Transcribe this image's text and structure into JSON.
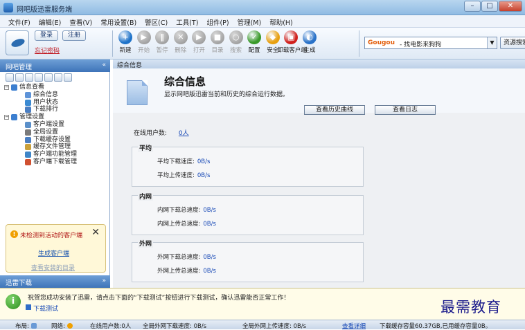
{
  "window": {
    "title": "网吧版迅雷服务端",
    "controls": [
      "–",
      "□",
      "✕"
    ]
  },
  "menu": [
    "文件(F)",
    "编辑(E)",
    "查看(V)",
    "常用设置(B)",
    "警区(C)",
    "工具(T)",
    "组件(P)",
    "管理(M)",
    "帮助(H)"
  ],
  "account": {
    "login": "登录",
    "register": "注册",
    "forgot": "忘记密码"
  },
  "toolbar": [
    {
      "label": "新建",
      "icon": "new-icon",
      "enabled": true,
      "color": "#1f73c9"
    },
    {
      "label": "开始",
      "icon": "play-icon",
      "enabled": false
    },
    {
      "label": "暂停",
      "icon": "pause-icon",
      "enabled": false
    },
    {
      "label": "删除",
      "icon": "delete-icon",
      "enabled": false
    },
    {
      "label": "打开",
      "icon": "open-icon",
      "enabled": false
    },
    {
      "label": "目录",
      "icon": "folder-icon",
      "enabled": false
    },
    {
      "label": "搜索",
      "icon": "search-icon",
      "enabled": false
    },
    {
      "label": "配置",
      "icon": "config-icon",
      "enabled": true,
      "color": "#3a9a2a"
    },
    {
      "label": "安全",
      "icon": "shield-icon",
      "enabled": true,
      "color": "#e8a010"
    },
    {
      "label": "卸载客户端",
      "icon": "uninstall-icon",
      "enabled": true,
      "color": "#d0201c"
    },
    {
      "label": "生成",
      "icon": "generate-icon",
      "enabled": true,
      "color": "#2a72c8"
    }
  ],
  "search": {
    "brand": "Gougou",
    "query": "- 找电影来狗狗",
    "button": "资源搜索"
  },
  "sidebar": {
    "header": "网吧管理",
    "tree": [
      {
        "label": "信息查看",
        "level": 0,
        "expand": "−",
        "color": "#3c7fd0"
      },
      {
        "label": "综合信息",
        "level": 1,
        "color": "#5d93d8"
      },
      {
        "label": "用户状态",
        "level": 1,
        "color": "#3b8ad2"
      },
      {
        "label": "下载排行",
        "level": 1,
        "color": "#4a7ec2"
      },
      {
        "label": "管理设置",
        "level": 0,
        "expand": "−",
        "color": "#3c7fd0"
      },
      {
        "label": "客户端设置",
        "level": 1,
        "color": "#5a8fc9"
      },
      {
        "label": "全局设置",
        "level": 1,
        "color": "#7a7a7a"
      },
      {
        "label": "下载缓存设置",
        "level": 1,
        "color": "#4a7ec2"
      },
      {
        "label": "缓存文件管理",
        "level": 1,
        "color": "#c9a03c"
      },
      {
        "label": "客户端功能管理",
        "level": 1,
        "color": "#3f86c8"
      },
      {
        "label": "客户端下载管理",
        "level": 1,
        "color": "#d05030"
      }
    ],
    "notice": {
      "message": "未检测到活动的客户端",
      "link1": "生成客户端",
      "link2": "查看安装的目录"
    },
    "footer": "迅雷下载"
  },
  "content": {
    "breadcrumb": "综合信息",
    "title": "综合信息",
    "description": "显示网吧版迅雷当前和历史的综合运行数据。",
    "btn_history": "查看历史曲线",
    "btn_log": "查看日志",
    "online_label": "在线用户数:",
    "online_value": "0人",
    "groups": [
      {
        "title": "平均",
        "rows": [
          {
            "label": "平均下载速度:",
            "value": "0B/s"
          },
          {
            "label": "平均上传速度:",
            "value": "0B/s"
          }
        ]
      },
      {
        "title": "内网",
        "rows": [
          {
            "label": "内网下载总速度:",
            "value": "0B/s"
          },
          {
            "label": "内网上传总速度:",
            "value": "0B/s"
          }
        ]
      },
      {
        "title": "外网",
        "rows": [
          {
            "label": "外网下载总速度:",
            "value": "0B/s"
          },
          {
            "label": "外网上传总速度:",
            "value": "0B/s"
          }
        ]
      }
    ]
  },
  "hint": {
    "text": "祝贺您成功安装了迅雷，请点击下面的“下载测试”按钮进行下载测试，确认迅雷能否正常工作！",
    "button": "下载测试"
  },
  "watermark": "最需教育",
  "status": {
    "layout_label": "布局:",
    "network_label": "网络:",
    "online": "在线用户数:0人",
    "wan_down": "全局外网下载速度: 0B/s",
    "wan_up": "全局外网上传速度: 0B/s",
    "detail": "查看详细",
    "cache": "下载缓存容量60.37GB,已用缓存容量0B。"
  }
}
